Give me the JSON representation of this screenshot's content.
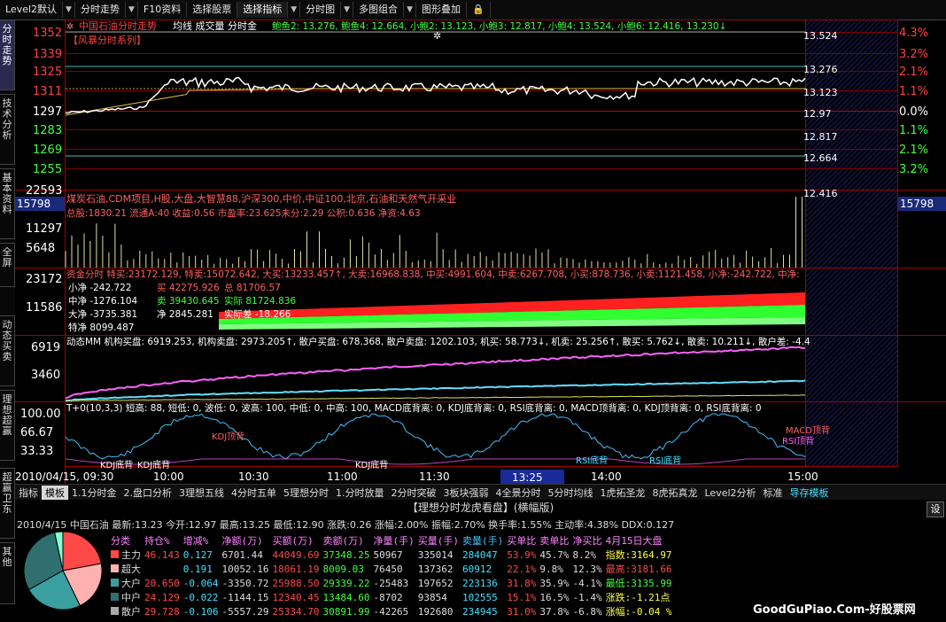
{
  "toolbar": {
    "items": [
      "Level2默认",
      "分时走势",
      "F10资料",
      "选择股票",
      "选择指标",
      "分时图",
      "多图组合",
      "图形叠加"
    ]
  },
  "left_tabs": [
    "分时走势",
    "技术分析",
    "基本资料",
    "全屏",
    "动态买卖",
    "理想超赢",
    "超赢卫东",
    "其他"
  ],
  "price_panel": {
    "title": "中国石油分时走势",
    "toggles": "均线  成交量  分时金",
    "legend": "鲍鱼2: 13.276, 鲍鱼4: 12.664, 小鲍2: 13.123, 小鲍3: 12.817, 小鲍4: 13.524, 小鲍6: 12.416, 13.230↓",
    "series_label": "【风暴分时系列】",
    "left_ticks": [
      "1352",
      "1339",
      "1325",
      "1311",
      "1297",
      "1283",
      "1269",
      "1255"
    ],
    "right_levels": [
      "13.524",
      "13.276",
      "13.123",
      "12.97",
      "12.817",
      "12.664",
      "12.416"
    ],
    "pct_ticks": [
      "4.3%",
      "3.2%",
      "2.1%",
      "1.1%",
      "0.0%",
      "1.1%",
      "2.1%",
      "3.2%"
    ]
  },
  "volume_panel": {
    "sector": "煤炭石油,CDM项目,H股,大盘,大智慧88,沪深300,中价,中证100,北京,石油和天然气开采业",
    "info": "总股:1830.21 流通A:40 收益:0.56 市盈率:23.625未分:2.29 公积:0.636 净资:4.63",
    "left_ticks": [
      "22593",
      "15798",
      "11297",
      "5648"
    ],
    "right_value": "15798"
  },
  "fund_panel": {
    "header": "资金分时 特买:23172.129, 特卖:15072.642, 大买:13233.457↑, 大卖:16968.838, 中买:4991.604, 中卖:6267.708, 小买:878.736, 小卖:1121.458, 小净:-242.722, 中净:",
    "lines": [
      "小净 -242.722",
      "买 42275.926",
      "总 81706.57",
      "中净 -1276.104",
      "卖 39430.645",
      "实际 81724.836",
      "大净 -3735.381",
      "净 2845.281",
      "实际差 -18.266",
      "特净 8099.487"
    ],
    "left_ticks": [
      "23172",
      "11586"
    ]
  },
  "dyn_panel": {
    "header": "动态MM 机构买盘: 6919.253, 机构卖盘: 2973.205↑, 散户买盘: 678.368, 散户卖盘: 1202.103, 机买: 58.773↓, 机卖: 25.256↑, 散买: 5.762↓, 散卖: 10.211↓, 散户差: -4.4",
    "left_ticks": [
      "6919",
      "3460"
    ]
  },
  "t0_panel": {
    "header": "T+0(10,3,3) 短高: 88, 短低: 0, 波低: 0, 波高: 100, 中低: 0, 中高: 100, MACD底背离: 0, KDJ底背离: 0, RSI底背离: 0, MACD顶背离: 0, KDJ顶背离: 0, RSI底背离: 0",
    "left_ticks": [
      "100.00",
      "66.67",
      "33.33"
    ],
    "annotations": [
      "KDJ底背",
      "KDJ底背",
      "KDJ顶背",
      "KDJ底背",
      "RSI底背",
      "RSI底背",
      "MACD顶背",
      "RSI顶背"
    ]
  },
  "time_axis": [
    "2010/04/15, 09:30",
    "10:00",
    "10:30",
    "11:00",
    "11:30",
    "13:25",
    "14:00",
    "15:00"
  ],
  "tabstrip": [
    "指标",
    "模板",
    "1.1分时金",
    "2.盘口分析",
    "3理想五线",
    "4分时五单",
    "5理想分时",
    "1.分时放量",
    "2分时突破",
    "3板块强弱",
    "4全景分时",
    "5分时均线",
    "1虎拓圣龙",
    "8虎拓真龙",
    "Level2分析",
    "标准",
    "导存模板"
  ],
  "bottom": {
    "title": "【理想分时龙虎看盘】(横幅版)",
    "settings": "设",
    "info": "2010/4/15 中国石油  最新:13.23 今开:12.97 最高:13.25 最低:12.90 涨跌:0.26 涨幅:2.00% 振幅:2.70% 换手率:1.55% 主动率:4.38% DDX:0.127",
    "headers": [
      "分类",
      "持仓%",
      "增减%",
      "净额(万)",
      "买额(万)",
      "卖额(万)",
      "净量(手)",
      "买量(手)",
      "卖量(手)",
      "买单比",
      "卖单比",
      "净买比",
      "4月15日大盘"
    ],
    "rows": [
      [
        "主力",
        "46.143",
        "0.127",
        "6701.44",
        "44049.69",
        "37348.25",
        "50967",
        "335014",
        "284047",
        "53.9%",
        "45.7%",
        "8.2%",
        "指数:3164.97"
      ],
      [
        "超大",
        "",
        "0.191",
        "10052.16",
        "18061.19",
        "8009.03",
        "76450",
        "137362",
        "60912",
        "22.1%",
        "9.8%",
        "12.3%",
        "最高:3181.66"
      ],
      [
        "大户",
        "20.650",
        "-0.064",
        "-3350.72",
        "25988.50",
        "29339.22",
        "-25483",
        "197652",
        "223136",
        "31.8%",
        "35.9%",
        "-4.1%",
        "最低:3135.99"
      ],
      [
        "中户",
        "24.129",
        "-0.022",
        "-1144.15",
        "12340.45",
        "13484.60",
        "-8702",
        "93854",
        "102555",
        "15.1%",
        "16.5%",
        "-1.4%",
        "涨跌:-1.21点"
      ],
      [
        "散户",
        "29.728",
        "-0.106",
        "-5557.29",
        "25334.70",
        "30891.99",
        "-42265",
        "192680",
        "234945",
        "31.0%",
        "37.8%",
        "-6.8%",
        "涨幅:-0.04 %"
      ]
    ],
    "row_colors": [
      "#ff4848",
      "#ffb0b0",
      "#3a9f9f",
      "#2f6f6f",
      "#aaaaaa"
    ],
    "pie": [
      22.1,
      20.65,
      24.13,
      29.73,
      3.39
    ]
  },
  "watermark": "GoodGuPiao.Com-好股票网"
}
